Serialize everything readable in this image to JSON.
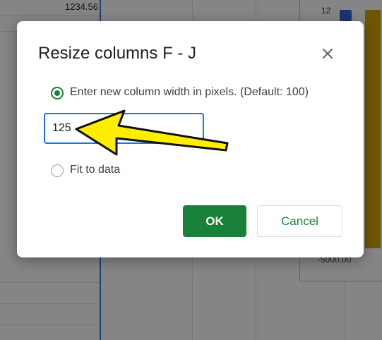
{
  "background": {
    "cells": [
      "1234.56",
      "…"
    ],
    "chart": {
      "y_ticks": [
        "12",
        "-5000.00"
      ]
    }
  },
  "dialog": {
    "title": "Resize columns F - J",
    "options": {
      "pixel_width_label": "Enter new column width in pixels. (Default: 100)",
      "fit_to_data_label": "Fit to data"
    },
    "width_value": "125",
    "ok_label": "OK",
    "cancel_label": "Cancel",
    "close_icon": "close-icon"
  },
  "annotation": {
    "arrow_color": "#ffee00",
    "points_to": "width-input"
  },
  "colors": {
    "accent_green": "#188038",
    "focus_blue": "#1a73e8",
    "bar_blue": "#3367d6",
    "bar_gold": "#d9a300"
  }
}
